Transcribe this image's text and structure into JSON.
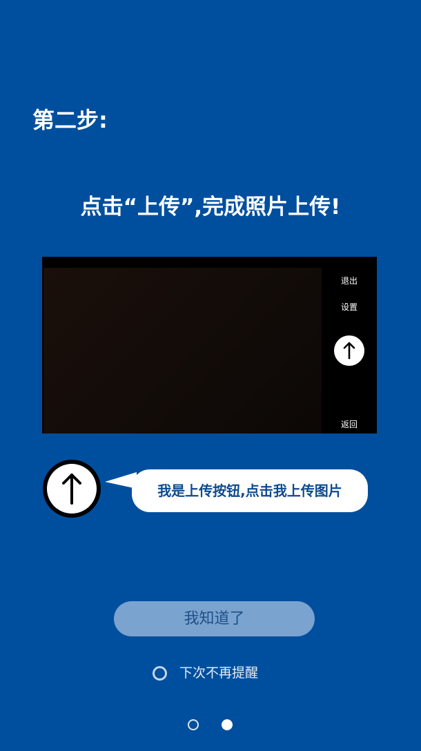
{
  "step_title": "第二步:",
  "instruction": "点击“上传”,完成照片上传!",
  "camera_preview": {
    "exit_label": "退出",
    "settings_label": "设置",
    "back_label": "返回",
    "upload_icon": "upload-arrow-icon"
  },
  "callout": {
    "icon": "upload-arrow-icon",
    "text": "我是上传按钮,点击我上传图片"
  },
  "got_it_button": "我知道了",
  "dont_remind": {
    "label": "下次不再提醒",
    "checked": false
  },
  "pagination": {
    "total": 2,
    "current": 2
  },
  "colors": {
    "background": "#004f9e",
    "button_bg": "#7aa3cf",
    "callout_text": "#0d4a8f"
  }
}
